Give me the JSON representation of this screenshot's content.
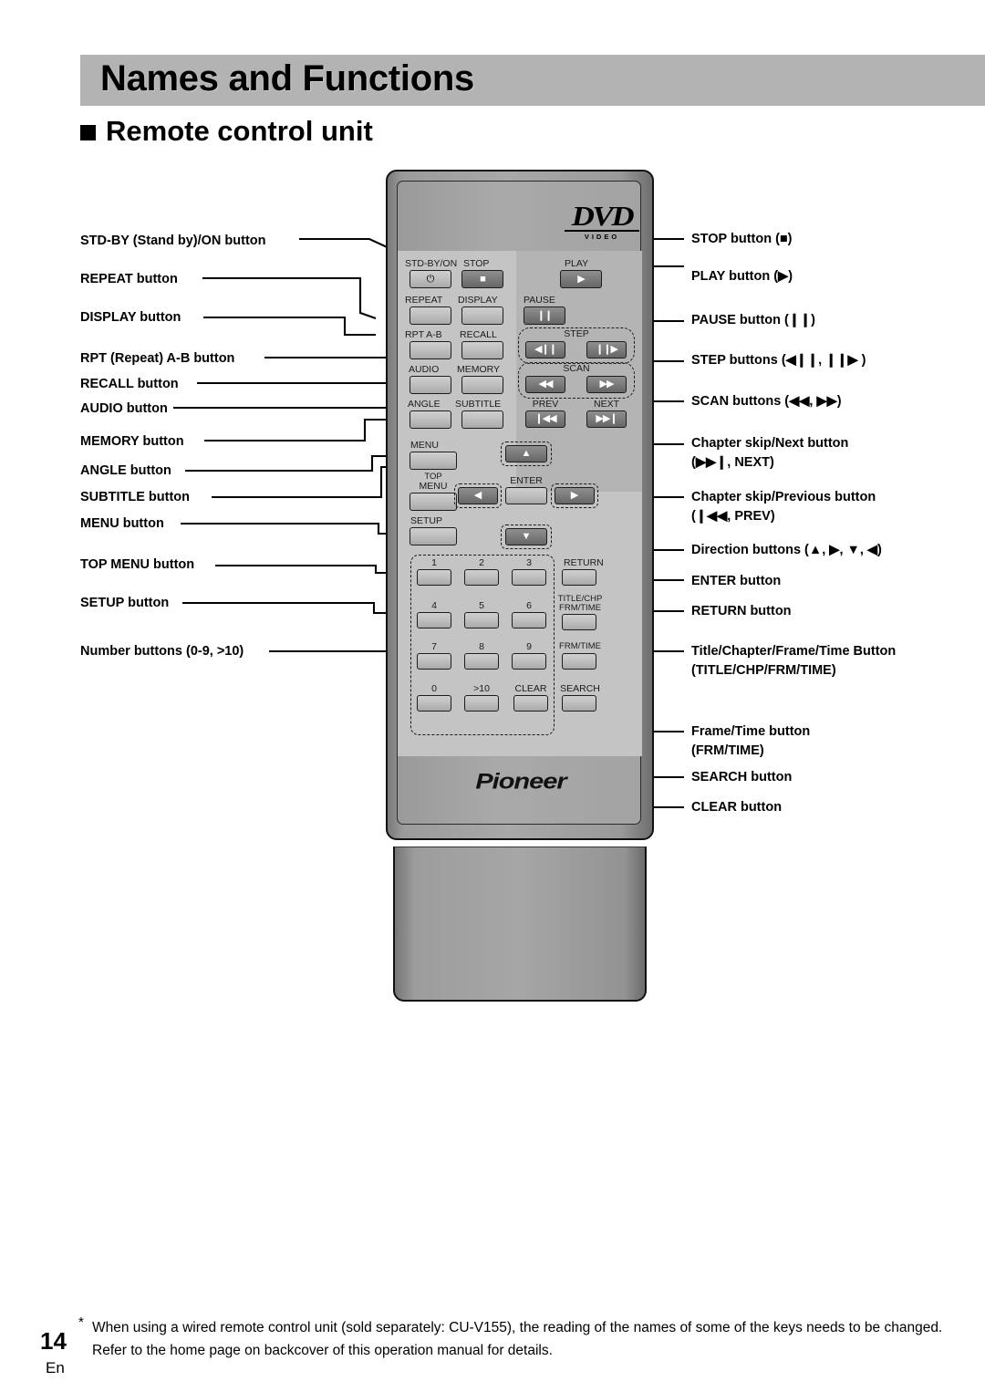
{
  "page": {
    "header_title": "Names and Functions",
    "section_title": "Remote control unit",
    "section_bullet": "square-bullet",
    "page_number": "14",
    "language_code": "En",
    "footnote_marker": "*",
    "footnote_text": "When using a wired remote control unit (sold separately: CU-V155), the reading of the names of some of the keys needs to be changed.  Refer to the home page on backcover of this operation manual for details.",
    "accent_gray": "#b3b3b3",
    "body_gray": "#a8a8a8",
    "keypanel_gray": "#c4c4c4"
  },
  "callouts_left": [
    {
      "label": "STD-BY (Stand by)/ON button"
    },
    {
      "label": "REPEAT button"
    },
    {
      "label": "DISPLAY button"
    },
    {
      "label": "RPT (Repeat) A-B button"
    },
    {
      "label": "RECALL button"
    },
    {
      "label": "AUDIO button"
    },
    {
      "label": "MEMORY button"
    },
    {
      "label": "ANGLE button"
    },
    {
      "label": "SUBTITLE button"
    },
    {
      "label": "MENU button"
    },
    {
      "label": "TOP MENU button"
    },
    {
      "label": "SETUP button"
    },
    {
      "label": "Number buttons (0-9, >10)"
    }
  ],
  "callouts_right": [
    {
      "line1": "STOP button (■)",
      "line2": ""
    },
    {
      "line1": "PLAY button (▶)",
      "line2": ""
    },
    {
      "line1": "PAUSE button (❙❙)",
      "line2": ""
    },
    {
      "line1": "STEP buttons (◀❙❙, ❙❙▶ )",
      "line2": ""
    },
    {
      "line1": "SCAN buttons (◀◀, ▶▶)",
      "line2": ""
    },
    {
      "line1": "Chapter skip/Next button",
      "line2": "(▶▶❙, NEXT)"
    },
    {
      "line1": "Chapter skip/Previous button",
      "line2": "(❙◀◀, PREV)"
    },
    {
      "line1": "Direction buttons (▲, ▶, ▼, ◀)",
      "line2": ""
    },
    {
      "line1": "ENTER button",
      "line2": ""
    },
    {
      "line1": "RETURN button",
      "line2": ""
    },
    {
      "line1": "Title/Chapter/Frame/Time Button",
      "line2": "(TITLE/CHP/FRM/TIME)"
    },
    {
      "line1": "Frame/Time button",
      "line2": "(FRM/TIME)"
    },
    {
      "line1": "SEARCH button",
      "line2": ""
    },
    {
      "line1": "CLEAR button",
      "line2": ""
    }
  ],
  "remote": {
    "brand": "Pioneer",
    "disc_logo_top": "DVD",
    "disc_logo_bottom": "VIDEO",
    "keys": {
      "std_by_on": "STD-BY/ON",
      "stop": "STOP",
      "play": "PLAY",
      "repeat": "REPEAT",
      "display": "DISPLAY",
      "pause": "PAUSE",
      "rpt_ab": "RPT A-B",
      "recall": "RECALL",
      "step": "STEP",
      "audio": "AUDIO",
      "memory": "MEMORY",
      "scan": "SCAN",
      "angle": "ANGLE",
      "subtitle": "SUBTITLE",
      "prev": "PREV",
      "next": "NEXT",
      "menu": "MENU",
      "top_menu_l1": "TOP",
      "top_menu_l2": "MENU",
      "enter": "ENTER",
      "setup": "SETUP",
      "return": "RETURN",
      "title_chp_l1": "TITLE/CHP",
      "title_chp_l2": "FRM/TIME",
      "frm_time": "FRM/TIME",
      "clear": "CLEAR",
      "search": "SEARCH"
    },
    "numpad": [
      "1",
      "2",
      "3",
      "4",
      "5",
      "6",
      "7",
      "8",
      "9",
      "0",
      ">10"
    ],
    "glyphs": {
      "power": "⏻",
      "stop": "■",
      "play": "▶",
      "pause": "❙❙",
      "step_back": "◀❙❙",
      "step_fwd": "❙❙▶",
      "scan_back": "◀◀",
      "scan_fwd": "▶▶",
      "prev": "❙◀◀",
      "next": "▶▶❙",
      "up": "▲",
      "down": "▼",
      "left": "◀",
      "right": "▶"
    }
  }
}
